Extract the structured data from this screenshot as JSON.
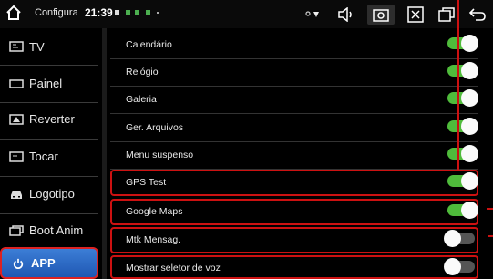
{
  "statusbar": {
    "title": "Configura",
    "time": "21:39"
  },
  "sidebar": {
    "items": [
      {
        "label": "TV",
        "icon": "tv-icon"
      },
      {
        "label": "Painel",
        "icon": "panel-icon"
      },
      {
        "label": "Reverter",
        "icon": "reverse-camera-icon"
      },
      {
        "label": "Tocar",
        "icon": "touch-icon"
      },
      {
        "label": "Logotipo",
        "icon": "car-icon"
      },
      {
        "label": "Boot Anim",
        "icon": "boot-anim-icon"
      },
      {
        "label": "APP",
        "icon": "power-icon",
        "active": true
      }
    ]
  },
  "apps": {
    "rows": [
      {
        "label": "Calendário",
        "on": true
      },
      {
        "label": "Relógio",
        "on": true
      },
      {
        "label": "Galeria",
        "on": true
      },
      {
        "label": "Ger. Arquivos",
        "on": true
      },
      {
        "label": "Menu suspenso",
        "on": true
      },
      {
        "label": "GPS Test",
        "on": true,
        "highlighted": true
      },
      {
        "label": "Google Maps",
        "on": true,
        "highlighted": true
      },
      {
        "label": "Mtk Mensag.",
        "on": false,
        "highlighted": true
      },
      {
        "label": "Mostrar seletor de voz",
        "on": false,
        "highlighted": true
      }
    ]
  },
  "colors": {
    "toggle_on": "#4fbb3b",
    "toggle_off": "#555555",
    "active_tab": "#2f6fcf",
    "highlight": "#cc1111"
  }
}
